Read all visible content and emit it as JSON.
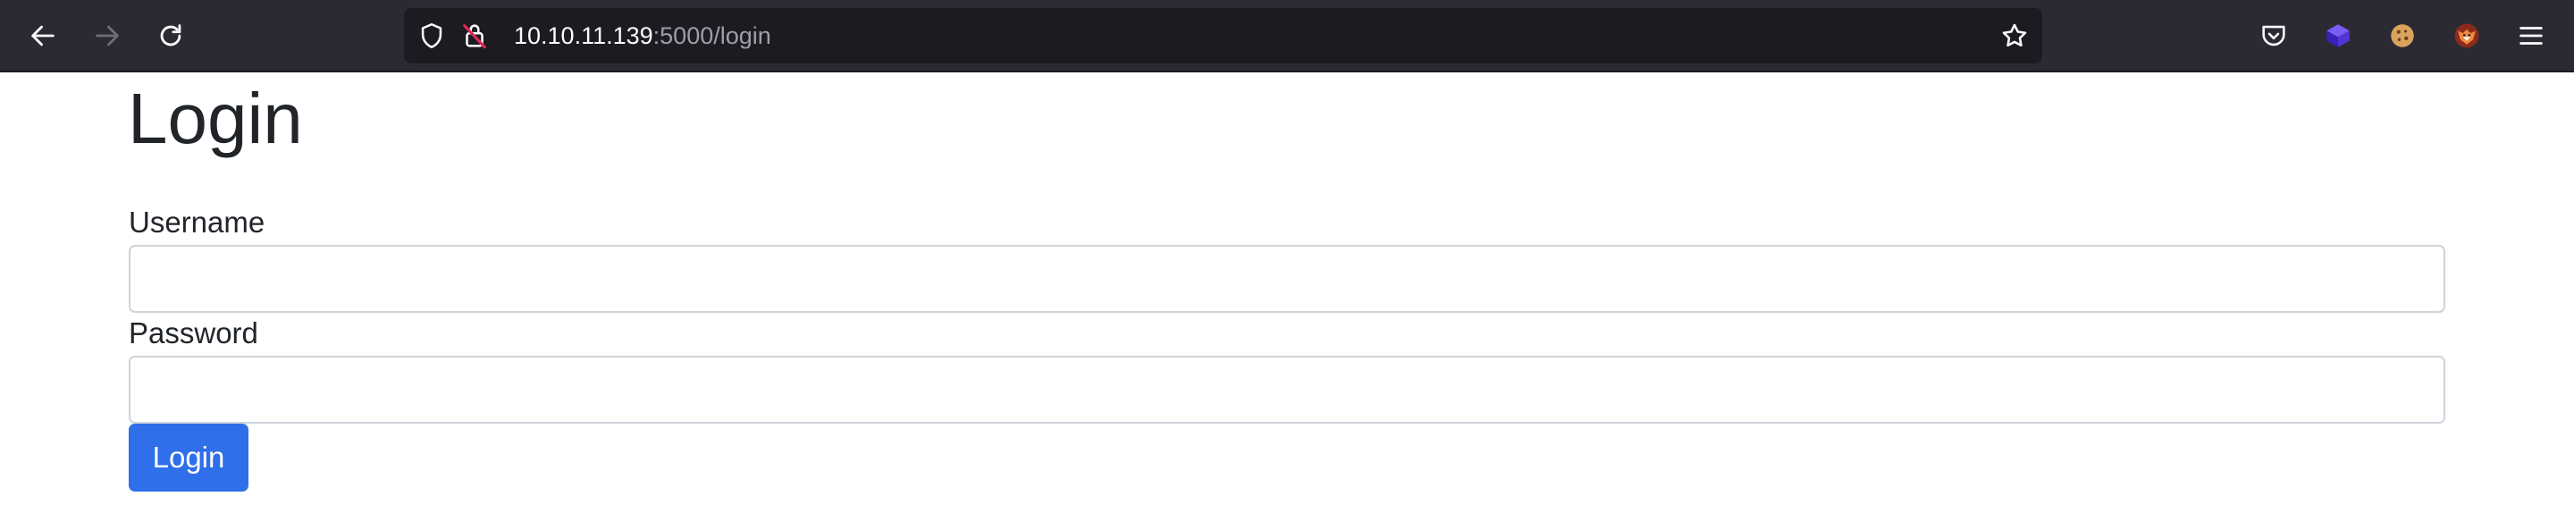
{
  "browser": {
    "url_host": "10.10.11.139",
    "url_path": ":5000/login",
    "icons": {
      "back": "arrow-left-icon",
      "forward": "arrow-right-icon",
      "reload": "reload-icon",
      "tracking": "shield-icon",
      "insecure": "insecure-lock-icon",
      "bookmark": "star-icon",
      "pocket": "pocket-icon",
      "extension_1": "purple-box-icon",
      "extension_2": "cookie-icon",
      "extension_3": "fox-icon",
      "menu": "hamburger-menu-icon"
    },
    "colors": {
      "toolbar": "#2b2a33",
      "urlbar": "#1c1b22",
      "url_host": "#fbfbfe",
      "url_path": "#9f9ea6"
    }
  },
  "page": {
    "title": "Login",
    "form": {
      "username_label": "Username",
      "username_value": "",
      "password_label": "Password",
      "password_value": "",
      "submit_label": "Login"
    },
    "colors": {
      "primary_button": "#2f6fe9",
      "text": "#212529",
      "input_border": "#ced4da"
    }
  }
}
